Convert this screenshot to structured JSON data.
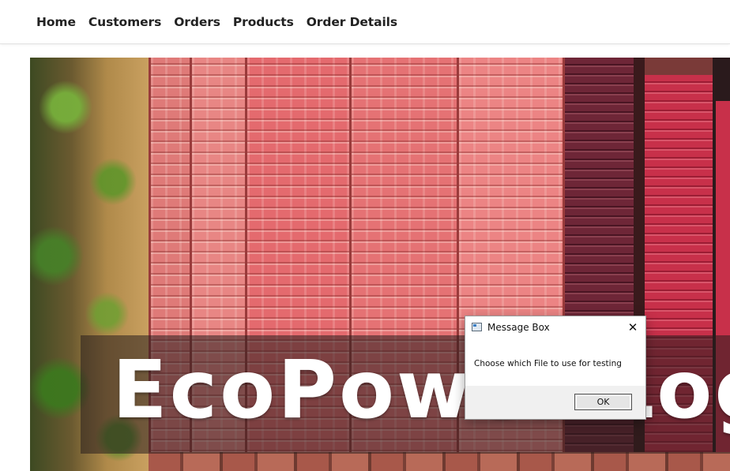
{
  "nav": {
    "items": [
      {
        "label": "Home"
      },
      {
        "label": "Customers"
      },
      {
        "label": "Orders"
      },
      {
        "label": "Products"
      },
      {
        "label": "Order Details"
      }
    ]
  },
  "hero": {
    "title": "EcoPower Log",
    "image": "shipping-containers-aerial"
  },
  "dialog": {
    "title": "Message Box",
    "message": "Choose which File to use for testing",
    "ok_label": "OK",
    "close_symbol": "✕"
  }
}
